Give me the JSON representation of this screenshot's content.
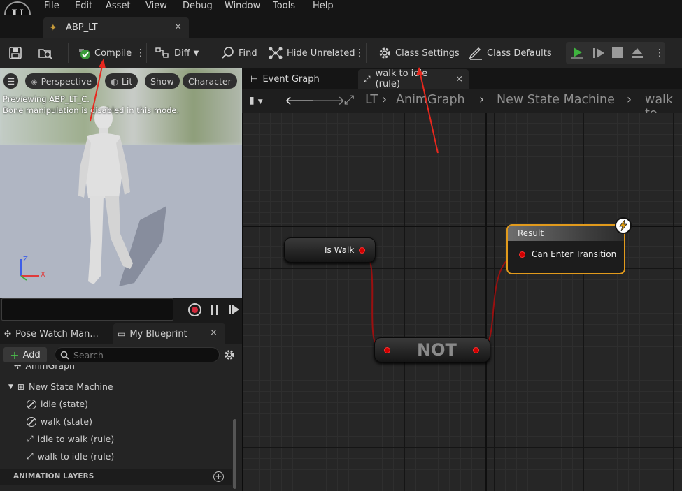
{
  "app": {
    "logo": "unreal-engine-logo"
  },
  "menu": [
    "File",
    "Edit",
    "Asset",
    "View",
    "Debug",
    "Window",
    "Tools",
    "Help"
  ],
  "document_tab": {
    "label": "ABP_LT",
    "close": "×"
  },
  "toolbar": {
    "compile": "Compile",
    "diff": "Diff",
    "find": "Find",
    "hide_unrelated": "Hide Unrelated",
    "class_settings": "Class Settings",
    "class_defaults": "Class Defaults"
  },
  "viewport": {
    "perspective": "Perspective",
    "lit": "Lit",
    "show": "Show",
    "character": "Character",
    "preview_line1": "Previewing ABP_LT_C.",
    "preview_line2": "Bone manipulation is disabled in this mode.",
    "axis_z": "Z",
    "axis_x": "X"
  },
  "panel_tabs": {
    "pose_watch": "Pose Watch Man...",
    "my_blueprint": "My Blueprint",
    "close": "×"
  },
  "my_blueprint": {
    "add": "Add",
    "search_placeholder": "Search",
    "items": {
      "anim_graph": "AnimGraph",
      "state_machine": "New State Machine",
      "idle_state": "idle (state)",
      "walk_state": "walk (state)",
      "idle_to_walk": "idle to walk (rule)",
      "walk_to_idle": "walk to idle (rule)"
    },
    "animation_layers": "ANIMATION LAYERS"
  },
  "graph_tabs": {
    "event_graph": "Event Graph",
    "active": "walk to idle (rule)",
    "close": "×"
  },
  "breadcrumb": {
    "lt": "LT",
    "anim_graph": "AnimGraph",
    "state_machine": "New State Machine",
    "current": "walk to"
  },
  "nodes": {
    "is_walk": "Is Walk",
    "not": "NOT",
    "result_title": "Result",
    "result_pin": "Can Enter Transition"
  },
  "colors": {
    "accent_orange": "#e19a1c",
    "bool_pin": "#d00000",
    "play_green": "#3fb33f",
    "annotation_arrow": "#e8281e"
  }
}
